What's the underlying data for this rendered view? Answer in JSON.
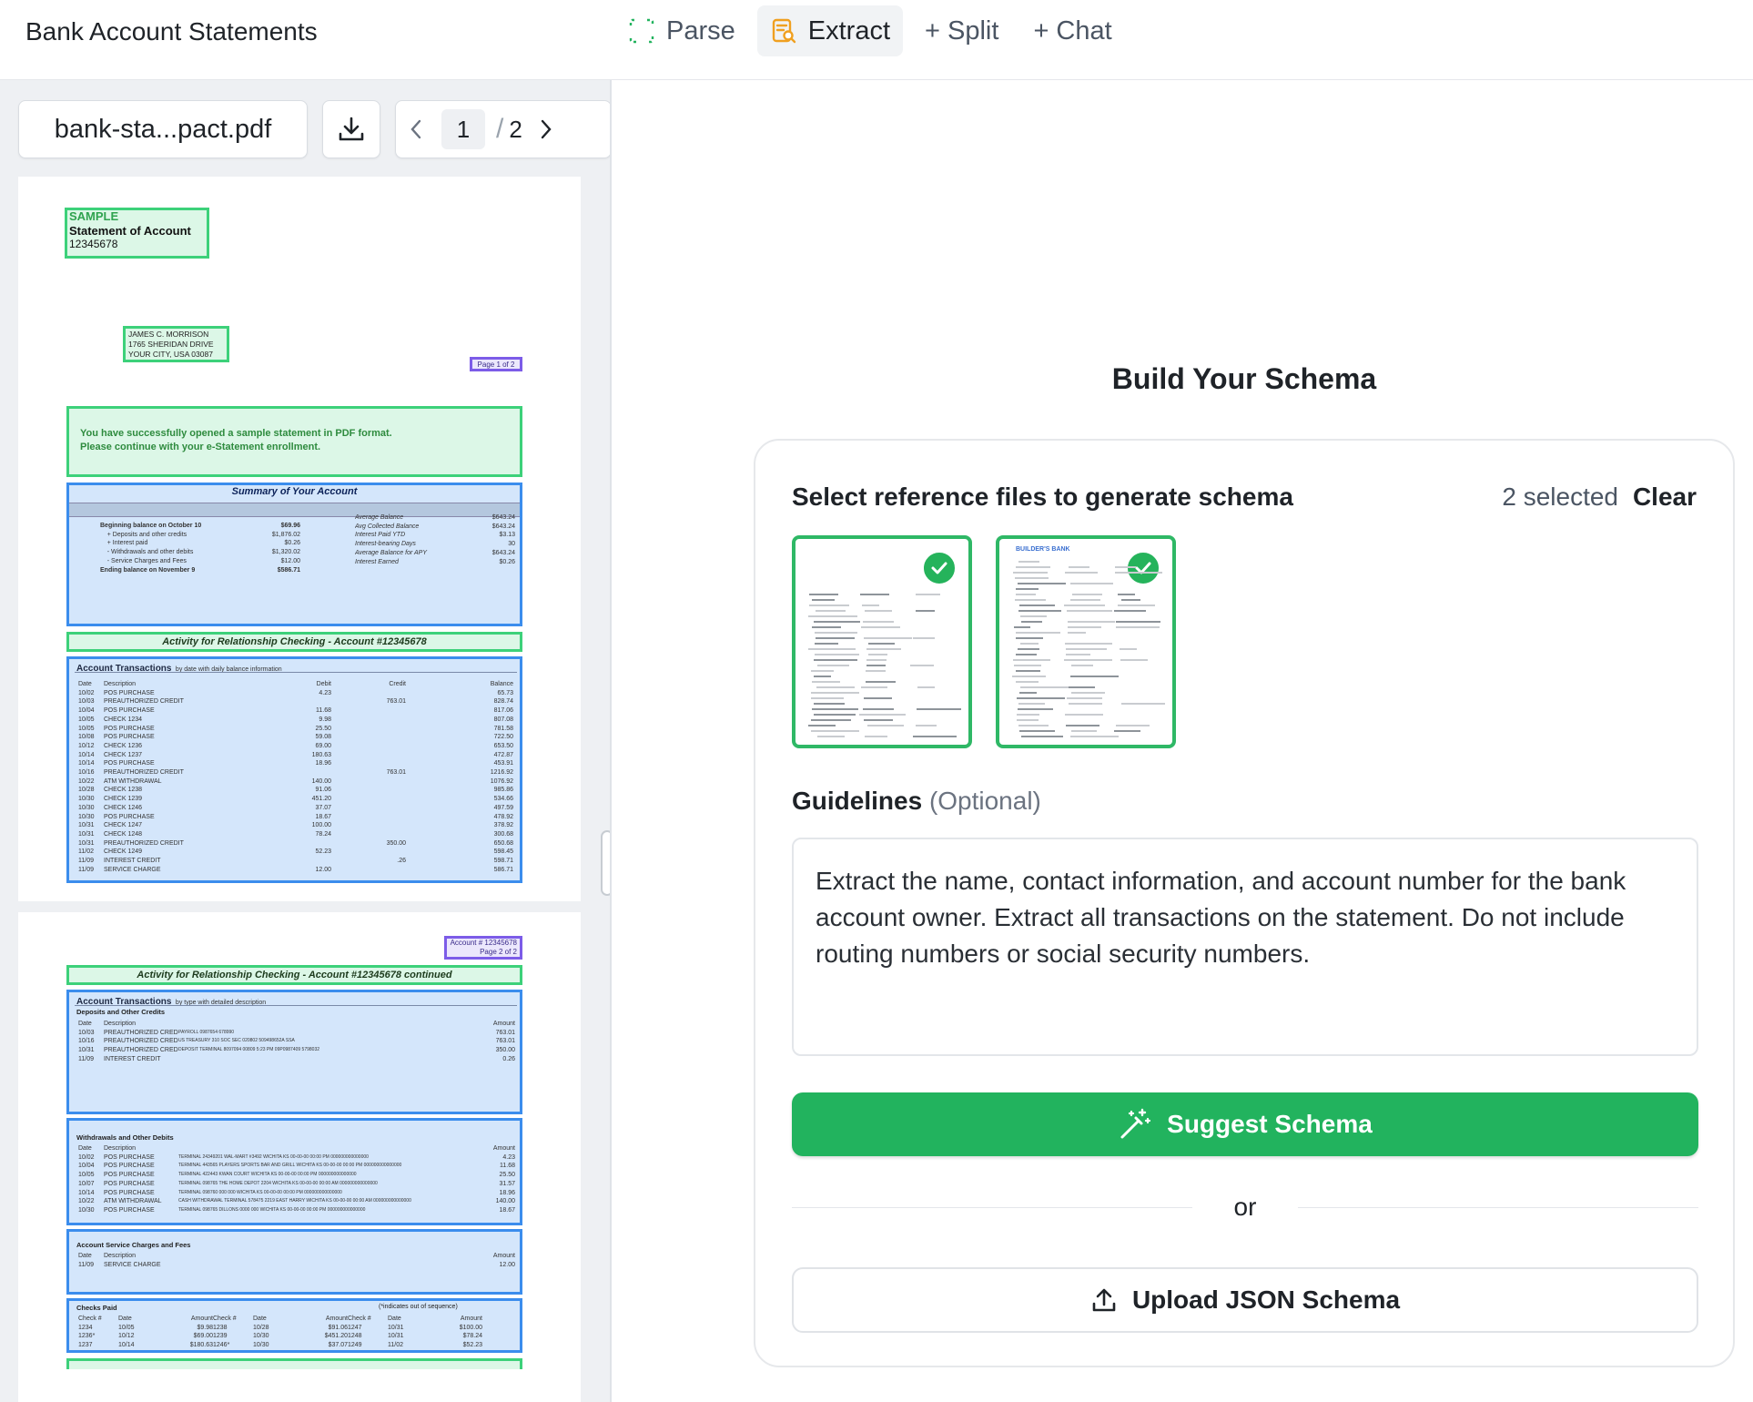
{
  "header": {
    "title": "Bank Account Statements",
    "tabs": [
      {
        "label": "Parse",
        "icon": "parse-icon"
      },
      {
        "label": "Extract",
        "icon": "extract-icon",
        "active": true
      },
      {
        "label": "+ Split"
      },
      {
        "label": "+ Chat"
      }
    ]
  },
  "viewer": {
    "filename": "bank-sta...pact.pdf",
    "current_page": "1",
    "page_separator": "/",
    "total_pages": "2",
    "page1": {
      "sample_title": "SAMPLE",
      "statement_title": "Statement of Account",
      "account_number": "12345678",
      "address": [
        "JAMES C. MORRISON",
        "1765 SHERIDAN DRIVE",
        "YOUR CITY, USA 03087"
      ],
      "page_label": "Page 1 of 2",
      "notice": [
        "You have successfully opened a sample statement in PDF format.",
        "Please continue with your e-Statement enrollment."
      ],
      "summary_title": "Summary of Your Account",
      "summary_left": [
        [
          "Beginning balance on October 10",
          "$69.96"
        ],
        [
          "+ Deposits and other credits",
          "$1,876.02"
        ],
        [
          "+ Interest paid",
          "$0.26"
        ],
        [
          "- Withdrawals and other debits",
          "$1,320.02"
        ],
        [
          "- Service Charges and Fees",
          "$12.00"
        ],
        [
          "Ending balance on November 9",
          "$586.71"
        ]
      ],
      "summary_right": [
        [
          "Average Balance",
          "$643.24"
        ],
        [
          "Avg Collected Balance",
          "$643.24"
        ],
        [
          "Interest Paid YTD",
          "$3.13"
        ],
        [
          "",
          ""
        ],
        [
          "",
          ""
        ],
        [
          "Interest-bearing Days",
          "30"
        ],
        [
          "Average Balance for APY",
          "$643.24"
        ],
        [
          "Interest Earned",
          "$0.26"
        ]
      ],
      "activity_banner": "Activity for Relationship Checking - Account #12345678",
      "transactions_title": "Account Transactions",
      "transactions_subtitle": "by date with daily balance information",
      "columns": [
        "Date",
        "Description",
        "Debit",
        "Credit",
        "Balance"
      ],
      "rows": [
        [
          "10/02",
          "POS PURCHASE",
          "4.23",
          "",
          "65.73"
        ],
        [
          "10/03",
          "PREAUTHORIZED CREDIT",
          "",
          "763.01",
          "828.74"
        ],
        [
          "10/04",
          "POS PURCHASE",
          "11.68",
          "",
          "817.06"
        ],
        [
          "10/05",
          "CHECK 1234",
          "9.98",
          "",
          "807.08"
        ],
        [
          "10/05",
          "POS PURCHASE",
          "25.50",
          "",
          "781.58"
        ],
        [
          "10/08",
          "POS PURCHASE",
          "59.08",
          "",
          "722.50"
        ],
        [
          "10/12",
          "CHECK 1236",
          "69.00",
          "",
          "653.50"
        ],
        [
          "10/14",
          "CHECK 1237",
          "180.63",
          "",
          "472.87"
        ],
        [
          "10/14",
          "POS PURCHASE",
          "18.96",
          "",
          "453.91"
        ],
        [
          "10/16",
          "PREAUTHORIZED CREDIT",
          "",
          "763.01",
          "1216.92"
        ],
        [
          "10/22",
          "ATM WITHDRAWAL",
          "140.00",
          "",
          "1076.92"
        ],
        [
          "10/28",
          "CHECK 1238",
          "91.06",
          "",
          "985.86"
        ],
        [
          "10/30",
          "CHECK 1239",
          "451.20",
          "",
          "534.66"
        ],
        [
          "10/30",
          "CHECK 1246",
          "37.07",
          "",
          "497.59"
        ],
        [
          "10/30",
          "POS PURCHASE",
          "18.67",
          "",
          "478.92"
        ],
        [
          "10/31",
          "CHECK 1247",
          "100.00",
          "",
          "378.92"
        ],
        [
          "10/31",
          "CHECK 1248",
          "78.24",
          "",
          "300.68"
        ],
        [
          "10/31",
          "PREAUTHORIZED CREDIT",
          "",
          "350.00",
          "650.68"
        ],
        [
          "11/02",
          "CHECK 1249",
          "52.23",
          "",
          "598.45"
        ],
        [
          "11/09",
          "INTEREST CREDIT",
          "",
          ".26",
          "598.71"
        ],
        [
          "11/09",
          "SERVICE CHARGE",
          "12.00",
          "",
          "586.71"
        ]
      ]
    },
    "page2": {
      "account_label": "Account # 12345678",
      "page_label": "Page 2 of 2",
      "activity_banner": "Activity for Relationship Checking - Account #12345678 continued",
      "transactions_title": "Account Transactions",
      "transactions_subtitle": "by type with detailed description",
      "deposits_title": "Deposits and Other Credits",
      "deposits_columns": [
        "Date",
        "Description",
        "Amount"
      ],
      "deposits": [
        [
          "10/03",
          "PREAUTHORIZED CREDIT",
          "PAYROLL 0987654 678990",
          "763.01"
        ],
        [
          "10/16",
          "PREAUTHORIZED CREDIT",
          "US TREASURY 310 SOC SEC 020802 509498652A SSA",
          "763.01"
        ],
        [
          "10/31",
          "PREAUTHORIZED CREDIT",
          "DEPOSIT TERMINAL 8097094 00809 5:23 PM 09P0987409 5798032",
          "350.00"
        ],
        [
          "11/09",
          "INTEREST CREDIT",
          "",
          "0.26"
        ]
      ],
      "withdrawals_title": "Withdrawals and Other Debits",
      "withdrawals_columns": [
        "Date",
        "Description",
        "Amount"
      ],
      "withdrawals": [
        [
          "10/02",
          "POS PURCHASE",
          "TERMINAL 24349201 WAL-MART #3492 WICHITA KS 00-00-00 00:00 PM 000000000000000",
          "4.23"
        ],
        [
          "10/04",
          "POS PURCHASE",
          "TERMINAL 443565 PLAYERS SPORTS BAR AND GRILL WICHITA KS 00-00-00 00:00 PM 000000000000000",
          "11.68"
        ],
        [
          "10/05",
          "POS PURCHASE",
          "TERMINAL 422443 KWAN COURT WICHITA KS 00-00-00 00:00 PM 000000000000000",
          "25.50"
        ],
        [
          "10/07",
          "POS PURCHASE",
          "TERMINAL 098765 THE HOME DEPOT 2204 WICHITA KS 00-00-00 00:00 AM 000000000000000",
          "31.57"
        ],
        [
          "10/14",
          "POS PURCHASE",
          "TERMINAL 098760 000 000 WICHITA KS 00-00-00 00:00 PM 000000000000000",
          "18.96"
        ],
        [
          "10/22",
          "ATM WITHDRAWAL",
          "CASH WITHDRAWAL TERMINAL 578475 2219 EAST HARRY WICHITA KS 00-00-00 00:00 AM 000000000000000",
          "140.00"
        ],
        [
          "10/30",
          "POS PURCHASE",
          "TERMINAL 098765 DILLONS 0000 000 WICHITA KS 00-00-00 00:00 PM 000000000000000",
          "18.67"
        ]
      ],
      "fees_title": "Account Service Charges and Fees",
      "fees_columns": [
        "Date",
        "Description",
        "Amount"
      ],
      "fees": [
        [
          "11/09",
          "SERVICE CHARGE",
          "12.00"
        ]
      ],
      "checks_title": "Checks Paid",
      "checks_note": "(*indicates out of sequence)",
      "checks_columns": [
        "Check #",
        "Date",
        "Amount"
      ],
      "checks": [
        [
          "1234",
          "10/05",
          "$9.98",
          "1238",
          "10/28",
          "$91.06",
          "1247",
          "10/31",
          "$100.00"
        ],
        [
          "1236*",
          "10/12",
          "$69.00",
          "1239",
          "10/30",
          "$451.20",
          "1248",
          "10/31",
          "$78.24"
        ],
        [
          "1237",
          "10/14",
          "$180.63",
          "1246*",
          "10/30",
          "$37.07",
          "1249",
          "11/02",
          "$52.23"
        ]
      ]
    }
  },
  "schema": {
    "title": "Build Your Schema",
    "reference_label": "Select reference files to generate schema",
    "selected_count": "2 selected",
    "clear_label": "Clear",
    "thumb2_bank_name": "BUILDER'S BANK",
    "guidelines_label": "Guidelines",
    "guidelines_optional": "(Optional)",
    "guidelines_text": "Extract the name, contact information, and account number for the bank account owner. Extract all transactions on the statement. Do not include routing numbers or social security numbers.",
    "suggest_label": "Suggest Schema",
    "or_label": "or",
    "upload_label": "Upload JSON Schema"
  },
  "colors": {
    "accent_green": "#22b35e",
    "highlight_green": "#3dd17a",
    "highlight_blue": "#3b8ded",
    "highlight_purple": "#7c5ce8"
  }
}
